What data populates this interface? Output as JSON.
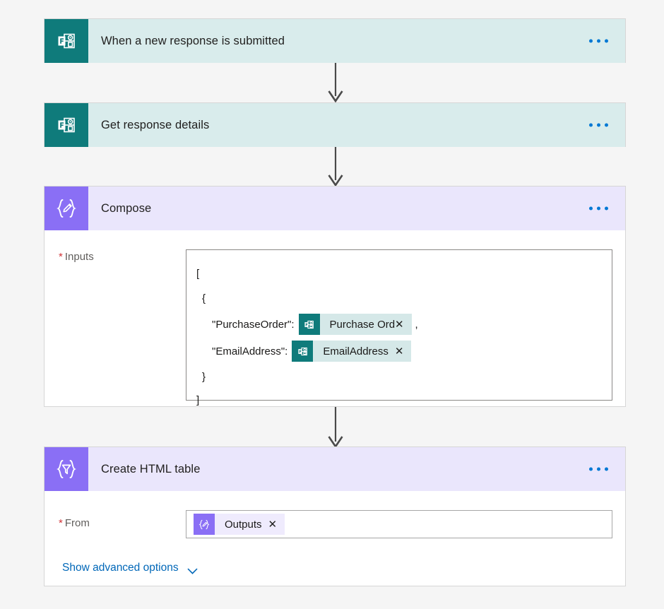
{
  "canvas": {
    "background": "#f5f5f5"
  },
  "colors": {
    "forms_accent": "#0f7b7b",
    "forms_header": "#d9ecec",
    "compose_accent": "#8a6ff5",
    "compose_header": "#eae6fc",
    "link": "#0067b8",
    "required": "#d13438",
    "ellipsis": "#0078d4",
    "arrow": "#4a4a4a"
  },
  "steps": [
    {
      "id": "trigger",
      "title": "When a new response is submitted",
      "icon": "microsoft-forms-icon",
      "theme": "forms",
      "menu_icon": "ellipsis-icon"
    },
    {
      "id": "get-response-details",
      "title": "Get response details",
      "icon": "microsoft-forms-icon",
      "theme": "forms",
      "menu_icon": "ellipsis-icon"
    },
    {
      "id": "compose",
      "title": "Compose",
      "icon": "compose-icon",
      "theme": "compose",
      "menu_icon": "ellipsis-icon",
      "field": {
        "label": "Inputs",
        "required_marker": "*",
        "code_lines": [
          {
            "type": "text",
            "text": "["
          },
          {
            "type": "text",
            "text": "{"
          },
          {
            "type": "token-line",
            "key": "\"PurchaseOrder\":",
            "token": {
              "label": "Purchase Orde...",
              "icon": "microsoft-forms-icon",
              "theme": "teal",
              "close_icon": "close-icon"
            },
            "suffix": ","
          },
          {
            "type": "token-line",
            "key": "\"EmailAddress\":",
            "token": {
              "label": "EmailAddress",
              "icon": "microsoft-forms-icon",
              "theme": "teal",
              "close_icon": "close-icon"
            },
            "suffix": ""
          },
          {
            "type": "text",
            "text": "}"
          },
          {
            "type": "text",
            "text": "]"
          }
        ]
      }
    },
    {
      "id": "create-html-table",
      "title": "Create HTML table",
      "icon": "create-html-table-icon",
      "theme": "compose",
      "menu_icon": "ellipsis-icon",
      "field": {
        "label": "From",
        "required_marker": "*",
        "token": {
          "label": "Outputs",
          "icon": "compose-icon",
          "theme": "purple",
          "close_icon": "close-icon"
        }
      },
      "advanced_options": {
        "label": "Show advanced options",
        "chevron_icon": "chevron-down-icon"
      }
    }
  ],
  "connectors": [
    {
      "id": "connector-1",
      "from": "trigger",
      "to": "get-response-details",
      "arrow_icon": "arrow-down-icon"
    },
    {
      "id": "connector-2",
      "from": "get-response-details",
      "to": "compose",
      "arrow_icon": "arrow-down-icon"
    },
    {
      "id": "connector-3",
      "from": "compose",
      "to": "create-html-table",
      "arrow_icon": "arrow-down-icon"
    }
  ]
}
